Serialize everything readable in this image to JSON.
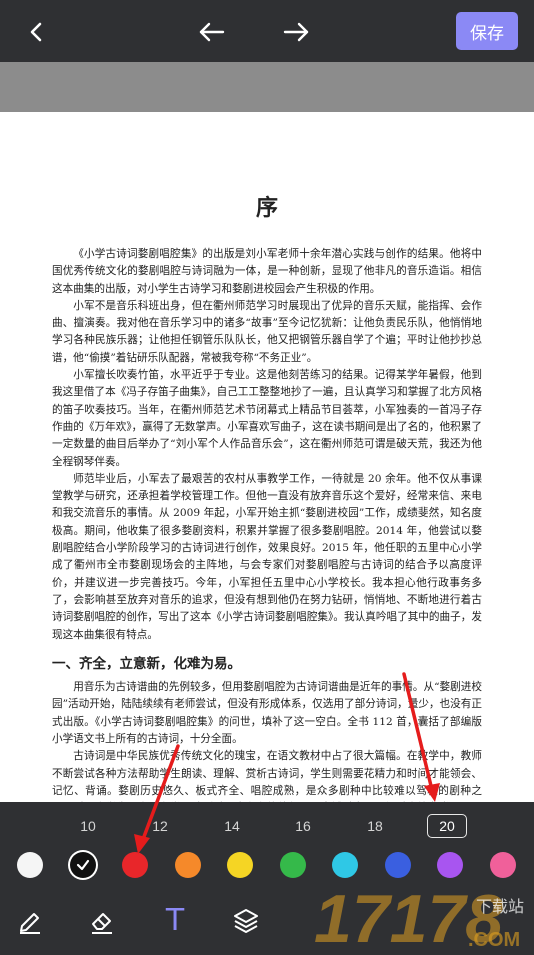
{
  "toolbar": {
    "save_label": "保存",
    "back_icon": "chevron-left-icon",
    "undo_icon": "arrow-left-icon",
    "redo_icon": "arrow-right-icon"
  },
  "document": {
    "title": "序",
    "paragraphs": [
      "《小学古诗词婺剧唱腔集》的出版是刘小军老师十余年潜心实践与创作的结果。他将中国优秀传统文化的婺剧唱腔与诗词融为一体，是一种创新，显现了他非凡的音乐造诣。相信这本曲集的出版，对小学生古诗学习和婺剧进校园会产生积极的作用。",
      "小军不是音乐科班出身，但在衢州师范学习时展现出了优异的音乐天赋，能指挥、会作曲、擅演奏。我对他在音乐学习中的诸多“故事”至今记忆犹新：让他负责民乐队，他悄悄地学习各种民族乐器；让他担任钢管乐队队长，他又把钢管乐器自学了个遍；平时让他抄抄总谱，他“偷摸”着钻研乐队配器，常被我夸称“不务正业”。",
      "小军擅长吹奏竹笛，水平近乎于专业。这是他刻苦练习的结果。记得某学年暑假，他到我这里借了本《冯子存笛子曲集》，自己工工整整地抄了一遍，且认真学习和掌握了北方风格的笛子吹奏技巧。当年，在衢州师范艺术节闭幕式上精品节目荟萃，小军独奏的一首冯子存作曲的《万年欢》，赢得了无数掌声。小军喜欢写曲子，这在读书期间是出了名的，他积累了一定数量的曲目后举办了“刘小军个人作品音乐会”，这在衢州师范可谓是破天荒，我还为他全程钢琴伴奏。",
      "师范毕业后，小军去了最艰苦的农村从事教学工作，一待就是 20 余年。他不仅从事课堂教学与研究，还承担着学校管理工作。但他一直没有放弃音乐这个爱好，经常来信、来电和我交流音乐的事情。从 2009 年起，小军开始主抓“婺剧进校园”工作，成绩斐然，知名度极高。期间，他收集了很多婺剧资料，积累并掌握了很多婺剧唱腔。2014 年，他尝试以婺剧唱腔结合小学阶段学习的古诗词进行创作，效果良好。2015 年，他任职的五里中心小学成了衢州市全市婺剧现场会的主阵地，与会专家们对婺剧唱腔与古诗词的结合予以高度评价，并建议进一步完善技巧。今年，小军担任五里中心小学校长。我本担心他行政事务多了，会影响甚至放弃对音乐的追求，但没有想到他仍在努力钻研，悄悄地、不断地进行着古诗词婺剧唱腔的创作，写出了这本《小学古诗词婺剧唱腔集》。我认真吟唱了其中的曲子，发现这本曲集很有特点。"
    ],
    "section_heading": "一、齐全，立意新，化难为易。",
    "section_paragraphs": [
      "用音乐为古诗谱曲的先例较多，但用婺剧唱腔为古诗词谱曲是近年的事情。从“婺剧进校园”活动开始，陆陆续续有老师尝试，但没有形成体系，仅选用了部分诗词，量少，也没有正式出版。《小学古诗词婺剧唱腔集》的问世，填补了这一空白。全书 112 首，囊括了部编版小学语文书上所有的古诗词，十分全面。",
      "古诗词是中华民族优秀传统文化的瑰宝，在语文教材中占了很大篇幅。在教学中，教师不断尝试各种方法帮助学生朗读、理解、赏析古诗词，学生则需要花精力和时间才能领会、记忆、背诵。婺剧历史悠久、板式齐全、唱腔成熟，是众多剧种中比较难以驾驭的剧种之一。对于小学生而言，在学习婺剧过程中存在旋律复杂、音域过宽、调门过高等各类问题。然而，随着《小学古诗词婺剧唱腔集》的出版，学生既能熟悉婺剧旋律，又能愉快地学习古诗，两件较难的事情相辅相成、互相促进，使难问题也就迎刃而解了。"
    ]
  },
  "size_options": [
    "10",
    "12",
    "14",
    "16",
    "18",
    "20"
  ],
  "selected_size": "20",
  "colors": [
    "#f5f5f5",
    "#111111",
    "#e8262a",
    "#f5892a",
    "#f5d524",
    "#35b94a",
    "#2fc8e6",
    "#3a5fe0",
    "#a855f0",
    "#f0609a"
  ],
  "selected_color": "#111111",
  "tools": [
    {
      "name": "pen-icon",
      "active": false
    },
    {
      "name": "eraser-icon",
      "active": false
    },
    {
      "name": "text-icon",
      "active": true
    },
    {
      "name": "layers-icon",
      "active": false
    }
  ],
  "text_tool_label": "T",
  "annotation_color": "#e51c1c",
  "watermark": {
    "brand": "17178",
    "suffix": ".COM",
    "tag": "下载站"
  }
}
